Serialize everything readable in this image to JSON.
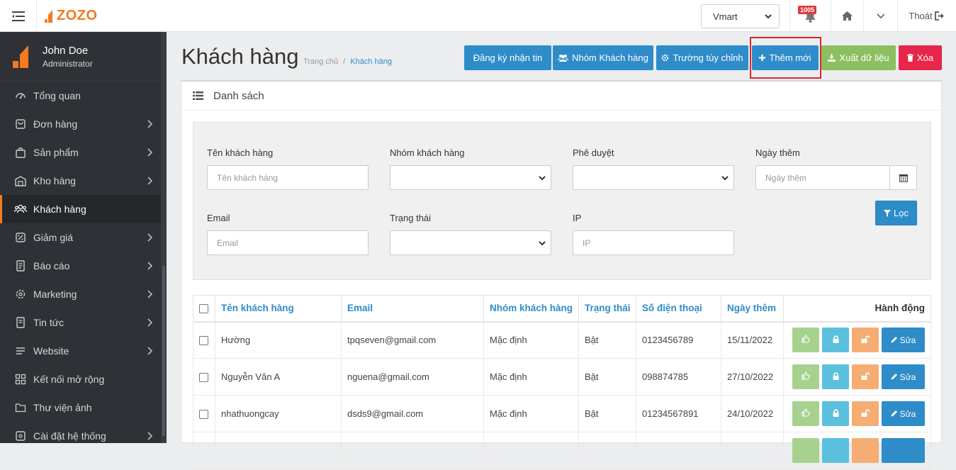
{
  "topbar": {
    "logo_text": "ZOZO",
    "store_select": "Vmart",
    "notification_count": "1005",
    "logout_label": "Thoát"
  },
  "sidebar": {
    "user_name": "John Doe",
    "user_role": "Administrator",
    "items": [
      {
        "label": "Tổng quan",
        "icon": "dashboard-icon",
        "arrow": false
      },
      {
        "label": "Đơn hàng",
        "icon": "order-icon",
        "arrow": true
      },
      {
        "label": "Sản phẩm",
        "icon": "bag-icon",
        "arrow": true
      },
      {
        "label": "Kho hàng",
        "icon": "warehouse-icon",
        "arrow": true
      },
      {
        "label": "Khách hàng",
        "icon": "customers-icon",
        "arrow": false,
        "active": true
      },
      {
        "label": "Giảm giá",
        "icon": "discount-icon",
        "arrow": true
      },
      {
        "label": "Báo cáo",
        "icon": "report-icon",
        "arrow": true
      },
      {
        "label": "Marketing",
        "icon": "marketing-icon",
        "arrow": true
      },
      {
        "label": "Tin tức",
        "icon": "news-icon",
        "arrow": true
      },
      {
        "label": "Website",
        "icon": "menu-icon",
        "arrow": true
      },
      {
        "label": "Kết nối mở rộng",
        "icon": "extension-icon",
        "arrow": false
      },
      {
        "label": "Thư viện ảnh",
        "icon": "folder-icon",
        "arrow": false
      },
      {
        "label": "Cài đặt hệ thống",
        "icon": "settings-icon",
        "arrow": true
      }
    ]
  },
  "header": {
    "title": "Khách hàng",
    "breadcrumb_home": "Trang chủ",
    "breadcrumb_sep": "/",
    "breadcrumb_current": "Khách hàng"
  },
  "actions": {
    "subscribe": "Đăng ký nhận tin",
    "groups": "Nhóm Khách hàng",
    "custom_fields": "Trường tùy chỉnh",
    "add_new": "Thêm mới",
    "export": "Xuất dữ liệu",
    "delete": "Xóa"
  },
  "panel": {
    "title": "Danh sách"
  },
  "filter": {
    "name_label": "Tên khách hàng",
    "name_placeholder": "Tên khách hàng",
    "group_label": "Nhóm khách hàng",
    "approval_label": "Phê duyệt",
    "date_label": "Ngày thêm",
    "date_placeholder": "Ngày thêm",
    "email_label": "Email",
    "email_placeholder": "Email",
    "status_label": "Trạng thái",
    "ip_label": "IP",
    "ip_placeholder": "IP",
    "filter_button": "Lọc"
  },
  "table": {
    "headers": [
      "Tên khách hàng",
      "Email",
      "Nhóm khách hàng",
      "Trạng thái",
      "Số điện thoại",
      "Ngày thêm",
      "Hành động"
    ],
    "edit_label": "Sửa",
    "rows": [
      {
        "name": "Hường",
        "email": "tpqseven@gmail.com",
        "group": "Mặc định",
        "status": "Bật",
        "phone": "0123456789",
        "date": "15/11/2022"
      },
      {
        "name": "Nguyễn Văn A",
        "email": "nguena@gmail.com",
        "group": "Mặc định",
        "status": "Bật",
        "phone": "098874785",
        "date": "27/10/2022"
      },
      {
        "name": "nhathuongcay",
        "email": "dsds9@gmail.com",
        "group": "Mặc định",
        "status": "Bật",
        "phone": "01234567891",
        "date": "24/10/2022"
      }
    ]
  },
  "colors": {
    "accent_blue": "#2e8cc9",
    "brand_orange": "#f47920",
    "approve_green": "#a6d18f",
    "lock_cyan": "#5bc0de",
    "unlock_orange": "#f5ad73",
    "export_green": "#8cbf5f",
    "delete_red": "#e6264a",
    "sidebar_bg": "#2f3136"
  }
}
